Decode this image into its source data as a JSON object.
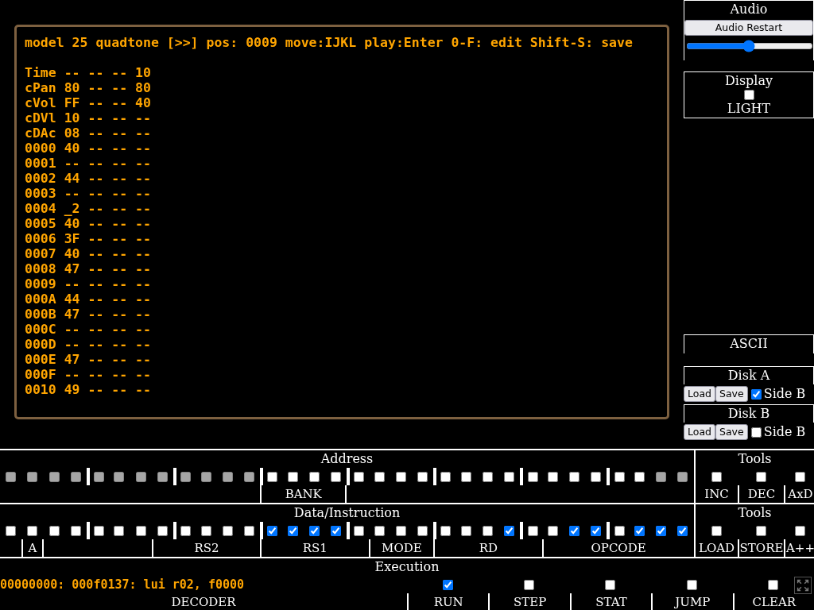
{
  "terminal": {
    "header": "model 25 quadtone [>>] pos: 0009 move:IJKL play:Enter 0-F: edit Shift-S: save",
    "lines": [
      "Time -- -- -- 10",
      "cPan 80 -- -- 80",
      "cVol FF -- -- 40",
      "cDVl 10 -- -- --",
      "cDAc 08 -- -- --",
      "0000 40 -- -- --",
      "0001 -- -- -- --",
      "0002 44 -- -- --",
      "0003 -- -- -- --",
      "0004 _2 -- -- --",
      "0005 40 -- -- --",
      "0006 3F -- -- --",
      "0007 40 -- -- --",
      "0008 47 -- -- --",
      "0009 -- -- -- --",
      "000A 44 -- -- --",
      "000B 47 -- -- --",
      "000C -- -- -- --",
      "000D -- -- -- --",
      "000E 47 -- -- --",
      "000F -- -- -- --",
      "0010 49 -- -- --"
    ]
  },
  "audio": {
    "title": "Audio",
    "restart_button": "Audio Restart",
    "volume": {
      "level": 0.49
    }
  },
  "display": {
    "title": "Display",
    "light": {
      "checked": false
    },
    "label": "LIGHT"
  },
  "ascii": {
    "title": "ASCII"
  },
  "disks": [
    {
      "title": "Disk A",
      "load_button": "Load",
      "save_button": "Save",
      "side_b": {
        "label": "Side B",
        "checked": true
      }
    },
    {
      "title": "Disk B",
      "load_button": "Load",
      "save_button": "Save",
      "side_b": {
        "label": "Side B",
        "checked": false
      }
    }
  ],
  "address": {
    "title": "Address",
    "bits": [
      {
        "checked": false,
        "disabled": true
      },
      {
        "checked": false,
        "disabled": true
      },
      {
        "checked": false,
        "disabled": true
      },
      {
        "checked": false,
        "disabled": true
      },
      {
        "checked": false,
        "disabled": true
      },
      {
        "checked": false,
        "disabled": true
      },
      {
        "checked": false,
        "disabled": true
      },
      {
        "checked": false,
        "disabled": true
      },
      {
        "checked": false,
        "disabled": true
      },
      {
        "checked": false,
        "disabled": true
      },
      {
        "checked": false,
        "disabled": true
      },
      {
        "checked": false,
        "disabled": true
      },
      {
        "checked": false,
        "disabled": false
      },
      {
        "checked": false,
        "disabled": false
      },
      {
        "checked": false,
        "disabled": false
      },
      {
        "checked": false,
        "disabled": false
      },
      {
        "checked": false,
        "disabled": false
      },
      {
        "checked": false,
        "disabled": false
      },
      {
        "checked": false,
        "disabled": false
      },
      {
        "checked": false,
        "disabled": false
      },
      {
        "checked": false,
        "disabled": false
      },
      {
        "checked": false,
        "disabled": false
      },
      {
        "checked": false,
        "disabled": false
      },
      {
        "checked": false,
        "disabled": false
      },
      {
        "checked": false,
        "disabled": false
      },
      {
        "checked": false,
        "disabled": false
      },
      {
        "checked": false,
        "disabled": false
      },
      {
        "checked": false,
        "disabled": false
      },
      {
        "checked": false,
        "disabled": false
      },
      {
        "checked": false,
        "disabled": false
      },
      {
        "checked": false,
        "disabled": true
      },
      {
        "checked": false,
        "disabled": true
      }
    ],
    "fields": [
      "BANK"
    ],
    "tools_title": "Tools",
    "tools": [
      {
        "label": "INC",
        "checked": false
      },
      {
        "label": "DEC",
        "checked": false
      },
      {
        "label": "AxD",
        "checked": false
      }
    ]
  },
  "data": {
    "title": "Data/Instruction",
    "bits": [
      {
        "checked": false
      },
      {
        "checked": false
      },
      {
        "checked": false
      },
      {
        "checked": false
      },
      {
        "checked": false
      },
      {
        "checked": false
      },
      {
        "checked": false
      },
      {
        "checked": false
      },
      {
        "checked": false
      },
      {
        "checked": false
      },
      {
        "checked": false
      },
      {
        "checked": false
      },
      {
        "checked": true
      },
      {
        "checked": true
      },
      {
        "checked": true
      },
      {
        "checked": true
      },
      {
        "checked": false
      },
      {
        "checked": false
      },
      {
        "checked": false
      },
      {
        "checked": false
      },
      {
        "checked": false
      },
      {
        "checked": false
      },
      {
        "checked": false
      },
      {
        "checked": true
      },
      {
        "checked": false
      },
      {
        "checked": false
      },
      {
        "checked": true
      },
      {
        "checked": true
      },
      {
        "checked": false
      },
      {
        "checked": true
      },
      {
        "checked": true
      },
      {
        "checked": true
      }
    ],
    "fields": [
      "A",
      "RS2",
      "RS1",
      "MODE",
      "RD",
      "OPCODE"
    ],
    "tools_title": "Tools",
    "tools": [
      {
        "label": "LOAD",
        "checked": false
      },
      {
        "label": "STORE",
        "checked": false
      },
      {
        "label": "A++",
        "checked": false
      }
    ]
  },
  "execution": {
    "title": "Execution",
    "decoder_output": "00000000: 000f0137: lui r02, f0000",
    "decoder_label": "DECODER",
    "controls": [
      {
        "label": "RUN",
        "checked": true
      },
      {
        "label": "STEP",
        "checked": false
      },
      {
        "label": "STAT",
        "checked": false
      },
      {
        "label": "JUMP",
        "checked": false
      },
      {
        "label": "CLEAR",
        "checked": false
      }
    ]
  }
}
